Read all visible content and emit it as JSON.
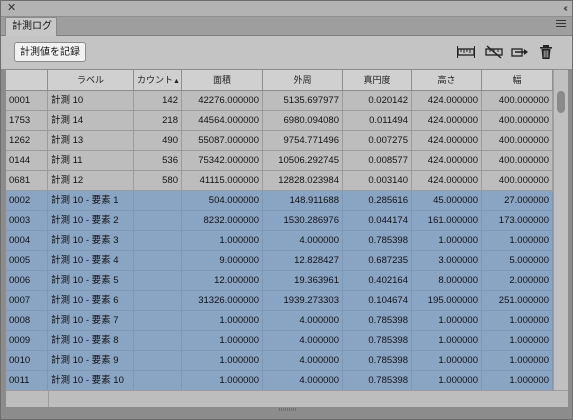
{
  "window": {
    "close_glyph": "✕",
    "collapse_glyph": "‹‹"
  },
  "tab": {
    "label": "計測ログ"
  },
  "toolbar": {
    "record_label": "計測値を記録",
    "icons": [
      "measure-scale-icon",
      "delete-scale-icon",
      "export-icon",
      "trash-icon"
    ]
  },
  "table": {
    "headers": [
      "",
      "ラベル",
      "カウント",
      "面積",
      "外周",
      "真円度",
      "高さ",
      "幅"
    ],
    "sort_indicator": "▲",
    "rows": [
      {
        "id": "0001",
        "label": "計測 10",
        "count": "142",
        "area": "42276.000000",
        "perimeter": "5135.697977",
        "circularity": "0.020142",
        "height": "424.000000",
        "width": "400.000000",
        "selected": false
      },
      {
        "id": "1753",
        "label": "計測 14",
        "count": "218",
        "area": "44564.000000",
        "perimeter": "6980.094080",
        "circularity": "0.011494",
        "height": "424.000000",
        "width": "400.000000",
        "selected": false
      },
      {
        "id": "1262",
        "label": "計測 13",
        "count": "490",
        "area": "55087.000000",
        "perimeter": "9754.771496",
        "circularity": "0.007275",
        "height": "424.000000",
        "width": "400.000000",
        "selected": false
      },
      {
        "id": "0144",
        "label": "計測 11",
        "count": "536",
        "area": "75342.000000",
        "perimeter": "10506.292745",
        "circularity": "0.008577",
        "height": "424.000000",
        "width": "400.000000",
        "selected": false
      },
      {
        "id": "0681",
        "label": "計測 12",
        "count": "580",
        "area": "41115.000000",
        "perimeter": "12828.023984",
        "circularity": "0.003140",
        "height": "424.000000",
        "width": "400.000000",
        "selected": false
      },
      {
        "id": "0002",
        "label": "計測 10 - 要素 1",
        "count": "",
        "area": "504.000000",
        "perimeter": "148.911688",
        "circularity": "0.285616",
        "height": "45.000000",
        "width": "27.000000",
        "selected": true
      },
      {
        "id": "0003",
        "label": "計測 10 - 要素 2",
        "count": "",
        "area": "8232.000000",
        "perimeter": "1530.286976",
        "circularity": "0.044174",
        "height": "161.000000",
        "width": "173.000000",
        "selected": true
      },
      {
        "id": "0004",
        "label": "計測 10 - 要素 3",
        "count": "",
        "area": "1.000000",
        "perimeter": "4.000000",
        "circularity": "0.785398",
        "height": "1.000000",
        "width": "1.000000",
        "selected": true
      },
      {
        "id": "0005",
        "label": "計測 10 - 要素 4",
        "count": "",
        "area": "9.000000",
        "perimeter": "12.828427",
        "circularity": "0.687235",
        "height": "3.000000",
        "width": "5.000000",
        "selected": true
      },
      {
        "id": "0006",
        "label": "計測 10 - 要素 5",
        "count": "",
        "area": "12.000000",
        "perimeter": "19.363961",
        "circularity": "0.402164",
        "height": "8.000000",
        "width": "2.000000",
        "selected": true
      },
      {
        "id": "0007",
        "label": "計測 10 - 要素 6",
        "count": "",
        "area": "31326.000000",
        "perimeter": "1939.273303",
        "circularity": "0.104674",
        "height": "195.000000",
        "width": "251.000000",
        "selected": true
      },
      {
        "id": "0008",
        "label": "計測 10 - 要素 7",
        "count": "",
        "area": "1.000000",
        "perimeter": "4.000000",
        "circularity": "0.785398",
        "height": "1.000000",
        "width": "1.000000",
        "selected": true
      },
      {
        "id": "0009",
        "label": "計測 10 - 要素 8",
        "count": "",
        "area": "1.000000",
        "perimeter": "4.000000",
        "circularity": "0.785398",
        "height": "1.000000",
        "width": "1.000000",
        "selected": true
      },
      {
        "id": "0010",
        "label": "計測 10 - 要素 9",
        "count": "",
        "area": "1.000000",
        "perimeter": "4.000000",
        "circularity": "0.785398",
        "height": "1.000000",
        "width": "1.000000",
        "selected": true
      },
      {
        "id": "0011",
        "label": "計測 10 - 要素 10",
        "count": "",
        "area": "1.000000",
        "perimeter": "4.000000",
        "circularity": "0.785398",
        "height": "1.000000",
        "width": "1.000000",
        "selected": true
      }
    ]
  },
  "colors": {
    "selection": "#8aa4c4",
    "row": "#bdbdbd",
    "panel": "#8c8c8c"
  }
}
